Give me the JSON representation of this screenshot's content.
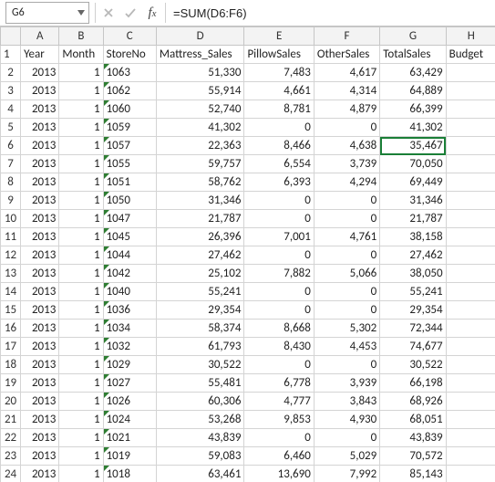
{
  "formula_bar": {
    "name_box": "G6",
    "formula": "=SUM(D6:F6)"
  },
  "column_letters": [
    "A",
    "B",
    "C",
    "D",
    "E",
    "F",
    "G",
    "H"
  ],
  "row_numbers": [
    "1",
    "2",
    "3",
    "4",
    "5",
    "6",
    "7",
    "8",
    "9",
    "10",
    "11",
    "12",
    "13",
    "14",
    "15",
    "16",
    "17",
    "18",
    "19",
    "20",
    "21",
    "22",
    "23",
    "24"
  ],
  "headers": {
    "A": "Year",
    "B": "Month",
    "C": "StoreNo",
    "D": "Mattress_Sales",
    "E": "PillowSales",
    "F": "OtherSales",
    "G": "TotalSales",
    "H": "Budget"
  },
  "active_column": "G",
  "active_cell_row_index": 4,
  "selection_start_row_index": 4,
  "selection_end_row_index": 22,
  "rows": [
    {
      "year": "2013",
      "month": "1",
      "store": "1063",
      "mat": "51,330",
      "pil": "7,483",
      "oth": "4,617",
      "tot": "63,429",
      "bud": ""
    },
    {
      "year": "2013",
      "month": "1",
      "store": "1062",
      "mat": "55,914",
      "pil": "4,661",
      "oth": "4,314",
      "tot": "64,889",
      "bud": ""
    },
    {
      "year": "2013",
      "month": "1",
      "store": "1060",
      "mat": "52,740",
      "pil": "8,781",
      "oth": "4,879",
      "tot": "66,399",
      "bud": ""
    },
    {
      "year": "2013",
      "month": "1",
      "store": "1059",
      "mat": "41,302",
      "pil": "0",
      "oth": "0",
      "tot": "41,302",
      "bud": ""
    },
    {
      "year": "2013",
      "month": "1",
      "store": "1057",
      "mat": "22,363",
      "pil": "8,466",
      "oth": "4,638",
      "tot": "35,467",
      "bud": ""
    },
    {
      "year": "2013",
      "month": "1",
      "store": "1055",
      "mat": "59,757",
      "pil": "6,554",
      "oth": "3,739",
      "tot": "70,050",
      "bud": ""
    },
    {
      "year": "2013",
      "month": "1",
      "store": "1051",
      "mat": "58,762",
      "pil": "6,393",
      "oth": "4,294",
      "tot": "69,449",
      "bud": ""
    },
    {
      "year": "2013",
      "month": "1",
      "store": "1050",
      "mat": "31,346",
      "pil": "0",
      "oth": "0",
      "tot": "31,346",
      "bud": ""
    },
    {
      "year": "2013",
      "month": "1",
      "store": "1047",
      "mat": "21,787",
      "pil": "0",
      "oth": "0",
      "tot": "21,787",
      "bud": ""
    },
    {
      "year": "2013",
      "month": "1",
      "store": "1045",
      "mat": "26,396",
      "pil": "7,001",
      "oth": "4,761",
      "tot": "38,158",
      "bud": ""
    },
    {
      "year": "2013",
      "month": "1",
      "store": "1044",
      "mat": "27,462",
      "pil": "0",
      "oth": "0",
      "tot": "27,462",
      "bud": ""
    },
    {
      "year": "2013",
      "month": "1",
      "store": "1042",
      "mat": "25,102",
      "pil": "7,882",
      "oth": "5,066",
      "tot": "38,050",
      "bud": ""
    },
    {
      "year": "2013",
      "month": "1",
      "store": "1040",
      "mat": "55,241",
      "pil": "0",
      "oth": "0",
      "tot": "55,241",
      "bud": ""
    },
    {
      "year": "2013",
      "month": "1",
      "store": "1036",
      "mat": "29,354",
      "pil": "0",
      "oth": "0",
      "tot": "29,354",
      "bud": ""
    },
    {
      "year": "2013",
      "month": "1",
      "store": "1034",
      "mat": "58,374",
      "pil": "8,668",
      "oth": "5,302",
      "tot": "72,344",
      "bud": ""
    },
    {
      "year": "2013",
      "month": "1",
      "store": "1032",
      "mat": "61,793",
      "pil": "8,430",
      "oth": "4,453",
      "tot": "74,677",
      "bud": ""
    },
    {
      "year": "2013",
      "month": "1",
      "store": "1029",
      "mat": "30,522",
      "pil": "0",
      "oth": "0",
      "tot": "30,522",
      "bud": ""
    },
    {
      "year": "2013",
      "month": "1",
      "store": "1027",
      "mat": "55,481",
      "pil": "6,778",
      "oth": "3,939",
      "tot": "66,198",
      "bud": ""
    },
    {
      "year": "2013",
      "month": "1",
      "store": "1026",
      "mat": "60,306",
      "pil": "4,777",
      "oth": "3,843",
      "tot": "68,926",
      "bud": ""
    },
    {
      "year": "2013",
      "month": "1",
      "store": "1024",
      "mat": "53,268",
      "pil": "9,853",
      "oth": "4,930",
      "tot": "68,051",
      "bud": ""
    },
    {
      "year": "2013",
      "month": "1",
      "store": "1021",
      "mat": "43,839",
      "pil": "0",
      "oth": "0",
      "tot": "43,839",
      "bud": ""
    },
    {
      "year": "2013",
      "month": "1",
      "store": "1019",
      "mat": "59,083",
      "pil": "6,460",
      "oth": "5,029",
      "tot": "70,572",
      "bud": ""
    },
    {
      "year": "2013",
      "month": "1",
      "store": "1018",
      "mat": "63,461",
      "pil": "13,690",
      "oth": "7,992",
      "tot": "85,143",
      "bud": ""
    }
  ],
  "chart_data": {
    "type": "table",
    "title": "",
    "columns": [
      "Year",
      "Month",
      "StoreNo",
      "Mattress_Sales",
      "PillowSales",
      "OtherSales",
      "TotalSales",
      "Budget"
    ],
    "rows": [
      [
        2013,
        1,
        1063,
        51330,
        7483,
        4617,
        63429,
        null
      ],
      [
        2013,
        1,
        1062,
        55914,
        4661,
        4314,
        64889,
        null
      ],
      [
        2013,
        1,
        1060,
        52740,
        8781,
        4879,
        66399,
        null
      ],
      [
        2013,
        1,
        1059,
        41302,
        0,
        0,
        41302,
        null
      ],
      [
        2013,
        1,
        1057,
        22363,
        8466,
        4638,
        35467,
        null
      ],
      [
        2013,
        1,
        1055,
        59757,
        6554,
        3739,
        70050,
        null
      ],
      [
        2013,
        1,
        1051,
        58762,
        6393,
        4294,
        69449,
        null
      ],
      [
        2013,
        1,
        1050,
        31346,
        0,
        0,
        31346,
        null
      ],
      [
        2013,
        1,
        1047,
        21787,
        0,
        0,
        21787,
        null
      ],
      [
        2013,
        1,
        1045,
        26396,
        7001,
        4761,
        38158,
        null
      ],
      [
        2013,
        1,
        1044,
        27462,
        0,
        0,
        27462,
        null
      ],
      [
        2013,
        1,
        1042,
        25102,
        7882,
        5066,
        38050,
        null
      ],
      [
        2013,
        1,
        1040,
        55241,
        0,
        0,
        55241,
        null
      ],
      [
        2013,
        1,
        1036,
        29354,
        0,
        0,
        29354,
        null
      ],
      [
        2013,
        1,
        1034,
        58374,
        8668,
        5302,
        72344,
        null
      ],
      [
        2013,
        1,
        1032,
        61793,
        8430,
        4453,
        74677,
        null
      ],
      [
        2013,
        1,
        1029,
        30522,
        0,
        0,
        30522,
        null
      ],
      [
        2013,
        1,
        1027,
        55481,
        6778,
        3939,
        66198,
        null
      ],
      [
        2013,
        1,
        1026,
        60306,
        4777,
        3843,
        68926,
        null
      ],
      [
        2013,
        1,
        1024,
        53268,
        9853,
        4930,
        68051,
        null
      ],
      [
        2013,
        1,
        1021,
        43839,
        0,
        0,
        43839,
        null
      ],
      [
        2013,
        1,
        1019,
        59083,
        6460,
        5029,
        70572,
        null
      ],
      [
        2013,
        1,
        1018,
        63461,
        13690,
        7992,
        85143,
        null
      ]
    ]
  }
}
